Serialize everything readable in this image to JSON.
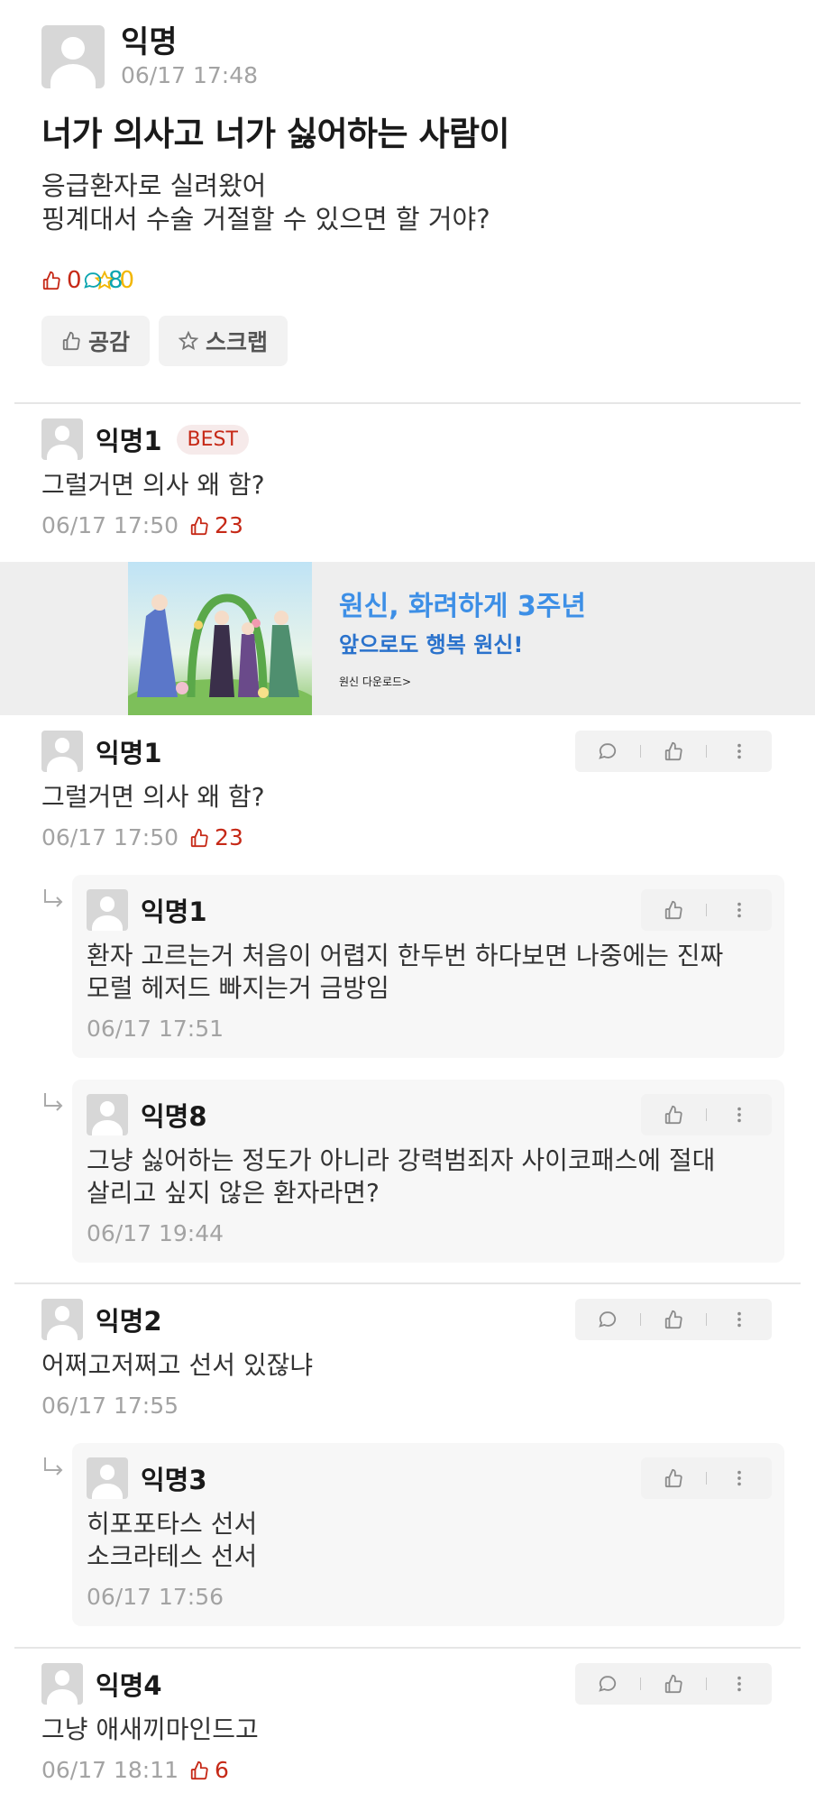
{
  "post": {
    "author": "익명",
    "time": "06/17 17:48",
    "title": "너가 의사고 너가 싫어하는 사람이",
    "body_lines": [
      "응급환자로 실려왔어",
      "핑계대서 수술 거절할 수 있으면 할 거야?"
    ],
    "like_count": "0",
    "comment_count": "8",
    "scrap_count": "0",
    "like_button": "공감",
    "scrap_button": "스크랩"
  },
  "best_comment": {
    "author": "익명1",
    "badge": "BEST",
    "text": "그럴거면 의사 왜 함?",
    "time": "06/17 17:50",
    "likes": "23"
  },
  "ad": {
    "headline": "원신, 화려하게 3주년",
    "subline": "앞으로도 행복 원신!",
    "link": "원신 다운로드>"
  },
  "comments": [
    {
      "author": "익명1",
      "text": "그럴거면 의사 왜 함?",
      "time": "06/17 17:50",
      "likes": "23",
      "replies": [
        {
          "author": "익명1",
          "lines": [
            "환자 고르는거 처음이 어렵지 한두번 하다보면 나중에는 진짜",
            "모럴 헤저드 빠지는거 금방임"
          ],
          "time": "06/17 17:51"
        },
        {
          "author": "익명8",
          "lines": [
            "그냥 싫어하는 정도가 아니라 강력범죄자 사이코패스에 절대",
            "살리고 싶지 않은 환자라면?"
          ],
          "time": "06/17 19:44"
        }
      ]
    },
    {
      "author": "익명2",
      "text": "어쩌고저쩌고 선서 있잖냐",
      "time": "06/17 17:55",
      "likes": "",
      "replies": [
        {
          "author": "익명3",
          "lines": [
            "히포포타스 선서",
            "소크라테스 선서"
          ],
          "time": "06/17 17:56"
        }
      ]
    },
    {
      "author": "익명4",
      "text": "그냥 애새끼마인드고",
      "time": "06/17 18:11",
      "likes": "6",
      "replies": []
    }
  ],
  "colors": {
    "like": "#c62917",
    "comment": "#0ca5b0",
    "scrap": "#f2b600",
    "ad_headline": "#3d8fe6"
  }
}
